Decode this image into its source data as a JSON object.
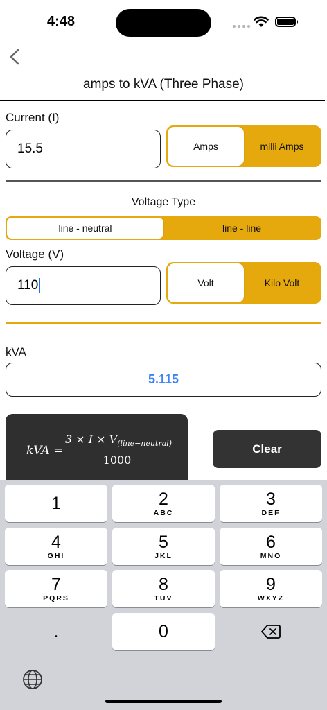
{
  "status_bar": {
    "time": "4:48"
  },
  "nav": {
    "title": "amps to kVA (Three Phase)"
  },
  "current": {
    "label": "Current (I)",
    "value": "15.5",
    "units": [
      "Amps",
      "milli Amps"
    ],
    "selected_unit": "Amps"
  },
  "voltage_type": {
    "title": "Voltage Type",
    "options": [
      "line - neutral",
      "line - line"
    ],
    "selected": "line - neutral"
  },
  "voltage": {
    "label": "Voltage (V)",
    "value": "110",
    "units": [
      "Volt",
      "Kilo Volt"
    ],
    "selected_unit": "Volt"
  },
  "result": {
    "label": "kVA",
    "value": "5.115"
  },
  "formula": {
    "lhs": "kVA =",
    "numerator": "3 × I × V",
    "subscript": "(line−neutral)",
    "denominator": "1000"
  },
  "clear_label": "Clear",
  "keyboard": {
    "keys": [
      {
        "digit": "1",
        "letters": ""
      },
      {
        "digit": "2",
        "letters": "ABC"
      },
      {
        "digit": "3",
        "letters": "DEF"
      },
      {
        "digit": "4",
        "letters": "GHI"
      },
      {
        "digit": "5",
        "letters": "JKL"
      },
      {
        "digit": "6",
        "letters": "MNO"
      },
      {
        "digit": "7",
        "letters": "PQRS"
      },
      {
        "digit": "8",
        "letters": "TUV"
      },
      {
        "digit": "9",
        "letters": "WXYZ"
      }
    ],
    "dot": ".",
    "zero": "0"
  },
  "colors": {
    "accent": "#e5a90e",
    "result_text": "#3b82f6",
    "dark_button": "#333333"
  }
}
